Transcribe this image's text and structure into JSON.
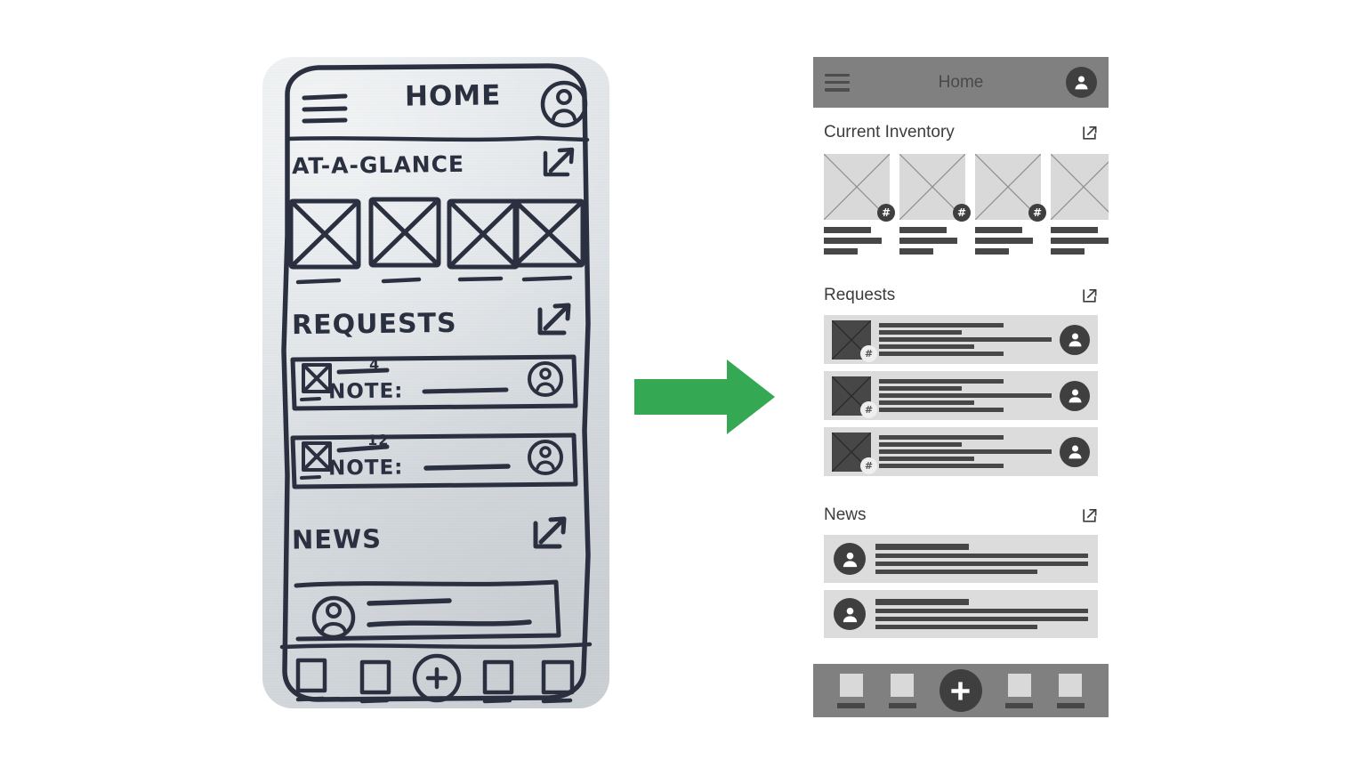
{
  "flow": {
    "arrow_color": "#35a853",
    "arrow_name": "transformation-arrow",
    "direction": "right"
  },
  "sketch": {
    "label": "hand-drawn-wireframe-sketch",
    "header": {
      "title": "HOME",
      "menu_icon": "hamburger-menu-icon",
      "avatar_icon": "account-avatar-icon"
    },
    "sections": [
      {
        "title": "AT-A-GLANCE",
        "action_icon": "external-link-icon"
      },
      {
        "title": "REQUESTS",
        "action_icon": "external-link-icon"
      },
      {
        "title": "NEWS",
        "action_icon": "external-link-icon"
      }
    ],
    "glance_tiles": 4,
    "requests": [
      {
        "count": "4",
        "note_label": "NOTE:"
      },
      {
        "count": "12",
        "note_label": "NOTE:"
      }
    ],
    "nav": {
      "items": 4,
      "fab_icon": "plus-icon"
    }
  },
  "mock": {
    "label": "digital-greyscale-wireframe",
    "header": {
      "title": "Home",
      "menu_icon": "hamburger-menu-icon",
      "avatar_icon": "account-avatar-icon",
      "bg": "#808080"
    },
    "sections": {
      "inventory": {
        "title": "Current Inventory",
        "action_icon": "external-link-icon",
        "cards": [
          {
            "thumb_icon": "image-placeholder-icon",
            "badge": "#",
            "lines": [
              72,
              88,
              52
            ]
          },
          {
            "thumb_icon": "image-placeholder-icon",
            "badge": "#",
            "lines": [
              72,
              88,
              52
            ]
          },
          {
            "thumb_icon": "image-placeholder-icon",
            "badge": "#",
            "lines": [
              72,
              88,
              52
            ]
          },
          {
            "thumb_icon": "image-placeholder-icon",
            "badge": "#",
            "lines": [
              72,
              88,
              52
            ]
          }
        ]
      },
      "requests": {
        "title": "Requests",
        "action_icon": "external-link-icon",
        "rows": [
          {
            "thumb_icon": "image-placeholder-icon",
            "badge": "#",
            "avatar_icon": "account-avatar-icon",
            "lines": [
              72,
              48,
              100,
              55,
              72
            ]
          },
          {
            "thumb_icon": "image-placeholder-icon",
            "badge": "#",
            "avatar_icon": "account-avatar-icon",
            "lines": [
              72,
              48,
              100,
              55,
              72
            ]
          },
          {
            "thumb_icon": "image-placeholder-icon",
            "badge": "#",
            "avatar_icon": "account-avatar-icon",
            "lines": [
              72,
              48,
              100,
              55,
              72
            ]
          }
        ]
      },
      "news": {
        "title": "News",
        "action_icon": "external-link-icon",
        "rows": [
          {
            "avatar_icon": "account-avatar-icon",
            "lines": [
              44,
              100,
              100,
              76
            ]
          },
          {
            "avatar_icon": "account-avatar-icon",
            "lines": [
              44,
              100,
              100,
              76
            ]
          }
        ]
      }
    },
    "nav": {
      "bg": "#808080",
      "items": [
        {
          "icon": "nav-square-icon"
        },
        {
          "icon": "nav-square-icon"
        },
        {
          "icon": "nav-square-icon"
        },
        {
          "icon": "nav-square-icon"
        }
      ],
      "fab": {
        "icon": "plus-icon",
        "label": "+"
      }
    }
  }
}
